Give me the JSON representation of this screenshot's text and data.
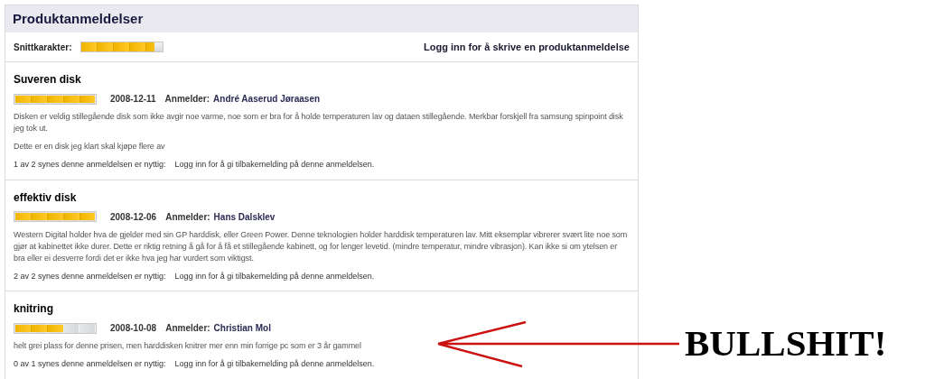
{
  "panel": {
    "title": "Produktanmeldelser",
    "average_label": "Snittkarakter:",
    "average": {
      "level": 0.9
    },
    "login_link": "Logg inn for å skrive en produktanmeldelse"
  },
  "reviews": [
    {
      "title": "Suveren disk",
      "rating": {
        "level": 1
      },
      "date": "2008-12-11",
      "reviewer_label": "Anmelder:",
      "reviewer": "André Aaserud Jøraasen",
      "paragraphs": [
        "Disken er veldig stillegående disk som ikke avgir noe varme, noe som er bra for å holde temperaturen lav og dataen stillegående. Merkbar forskjell fra samsung spinpoint disk jeg tok ut.",
        "Dette er en disk jeg klart skal kjøpe flere av"
      ],
      "helpful": "1 av 2 synes denne anmeldelsen er nyttig:",
      "feedback_link": "Logg inn for å gi tilbakemelding på denne anmeldelsen."
    },
    {
      "title": "effektiv disk",
      "rating": {
        "level": 1
      },
      "date": "2008-12-06",
      "reviewer_label": "Anmelder:",
      "reviewer": "Hans Dalsklev",
      "paragraphs": [
        "Western Digital holder hva de gjelder med sin GP harddisk, eller Green Power. Denne teknologien holder harddisk temperaturen lav. Mitt eksemplar vibrerer svært lite noe som gjør at kabinettet ikke durer. Dette er riktig retning å gå for å få et stillegående kabinett, og for lenger levetid. (mindre temperatur, mindre vibrasjon). Kan ikke si om ytelsen er bra eller ei desverre fordi det er ikke hva jeg har vurdert som viktigst."
      ],
      "helpful": "2 av 2 synes denne anmeldelsen er nyttig:",
      "feedback_link": "Logg inn for å gi tilbakemelding på denne anmeldelsen."
    },
    {
      "title": "knitring",
      "rating": {
        "level": 0.6
      },
      "date": "2008-10-08",
      "reviewer_label": "Anmelder:",
      "reviewer": "Christian Mol",
      "paragraphs": [
        "helt grei plass for denne prisen, men harddisken knitrer mer enn min forrige pc som er 3 år gammel"
      ],
      "helpful": "0 av 1 synes denne anmeldelsen er nyttig:",
      "feedback_link": "Logg inn for å gi tilbakemelding på denne anmeldelsen."
    }
  ],
  "annotation": {
    "text": "BULLSHIT!"
  }
}
